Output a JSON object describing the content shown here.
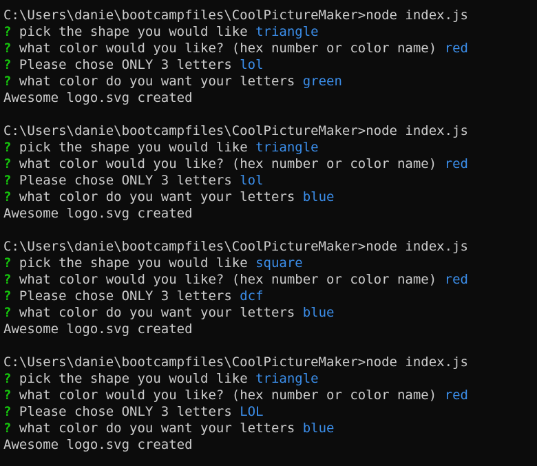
{
  "terminal": {
    "colors": {
      "background": "#0c0c0c",
      "foreground": "#cccccc",
      "question_mark": "#16c60c",
      "answer": "#3b8eea"
    },
    "question_mark": "?",
    "sessions": [
      {
        "command": "C:\\Users\\danie\\bootcampfiles\\CoolPictureMaker>node index.js",
        "prompts": [
          {
            "question": "pick the shape you would like",
            "answer": "triangle"
          },
          {
            "question": "what color would you like? (hex number or color name)",
            "answer": "red"
          },
          {
            "question": "Please chose ONLY 3 letters",
            "answer": "lol"
          },
          {
            "question": "what color do you want your letters",
            "answer": "green"
          }
        ],
        "result": "Awesome logo.svg created"
      },
      {
        "command": "C:\\Users\\danie\\bootcampfiles\\CoolPictureMaker>node index.js",
        "prompts": [
          {
            "question": "pick the shape you would like",
            "answer": "triangle"
          },
          {
            "question": "what color would you like? (hex number or color name)",
            "answer": "red"
          },
          {
            "question": "Please chose ONLY 3 letters",
            "answer": "lol"
          },
          {
            "question": "what color do you want your letters",
            "answer": "blue"
          }
        ],
        "result": "Awesome logo.svg created"
      },
      {
        "command": "C:\\Users\\danie\\bootcampfiles\\CoolPictureMaker>node index.js",
        "prompts": [
          {
            "question": "pick the shape you would like",
            "answer": "square"
          },
          {
            "question": "what color would you like? (hex number or color name)",
            "answer": "red"
          },
          {
            "question": "Please chose ONLY 3 letters",
            "answer": "dcf"
          },
          {
            "question": "what color do you want your letters",
            "answer": "blue"
          }
        ],
        "result": "Awesome logo.svg created"
      },
      {
        "command": "C:\\Users\\danie\\bootcampfiles\\CoolPictureMaker>node index.js",
        "prompts": [
          {
            "question": "pick the shape you would like",
            "answer": "triangle"
          },
          {
            "question": "what color would you like? (hex number or color name)",
            "answer": "red"
          },
          {
            "question": "Please chose ONLY 3 letters",
            "answer": "LOL"
          },
          {
            "question": "what color do you want your letters",
            "answer": "blue"
          }
        ],
        "result": "Awesome logo.svg created"
      }
    ]
  }
}
